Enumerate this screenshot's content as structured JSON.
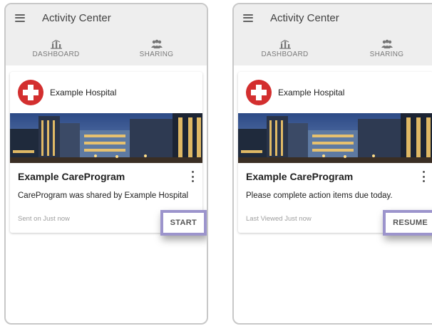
{
  "screens": [
    {
      "app_title": "Activity Center",
      "tabs": [
        {
          "label": "DASHBOARD",
          "icon": "dashboard-icon"
        },
        {
          "label": "SHARING",
          "icon": "people-icon"
        }
      ],
      "card": {
        "organization": "Example Hospital",
        "program_title": "Example CareProgram",
        "description": "CareProgram was shared by Example Hospital",
        "footer": "Sent on Just now",
        "action_label": "START"
      }
    },
    {
      "app_title": "Activity Center",
      "tabs": [
        {
          "label": "DASHBOARD",
          "icon": "dashboard-icon"
        },
        {
          "label": "SHARING",
          "icon": "people-icon"
        }
      ],
      "card": {
        "organization": "Example Hospital",
        "program_title": "Example CareProgram",
        "description": "Please complete action items due today.",
        "footer": "Last Viewed Just now",
        "action_label": "RESUME"
      }
    }
  ],
  "colors": {
    "appbar_bg": "#eeeeee",
    "logo_red": "#d32f2f",
    "highlight_border": "#9c94cc"
  }
}
